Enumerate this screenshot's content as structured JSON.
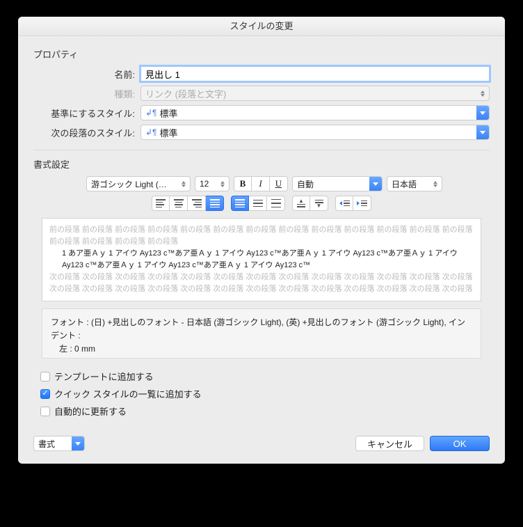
{
  "title": "スタイルの変更",
  "properties": {
    "heading": "プロパティ",
    "name_label": "名前:",
    "name_value": "見出し 1",
    "type_label": "種類:",
    "type_value": "リンク (段落と文字)",
    "base_label": "基準にするスタイル:",
    "base_value": "標準",
    "next_label": "次の段落のスタイル:",
    "next_value": "標準"
  },
  "formatting": {
    "heading": "書式設定",
    "font": "游ゴシック Light (見…",
    "size": "12",
    "bold": "B",
    "italic": "I",
    "underline": "U",
    "color": "自動",
    "language": "日本語"
  },
  "preview": {
    "prev_para": "前の段落 前の段落 前の段落 前の段落 前の段落 前の段落 前の段落 前の段落 前の段落 前の段落 前の段落 前の段落 前の段落 前の段落 前の段落 前の段落 前の段落",
    "sample": "1  あア亜Ａｙ  1  アイウ Ay123 c™あア亜Ａｙ  1  アイウ Ay123 c™あア亜Ａｙ  1  アイウ Ay123 c™あア亜Ａｙ  1  アイウ Ay123 c™あア亜Ａｙ  1  アイウ Ay123 c™あア亜Ａｙ  1  アイウ Ay123 c™",
    "next_para": "次の段落 次の段落 次の段落 次の段落 次の段落 次の段落 次の段落 次の段落 次の段落 次の段落 次の段落 次の段落 次の段落 次の段落 次の段落 次の段落 次の段落 次の段落 次の段落 次の段落 次の段落 次の段落 次の段落 次の段落 次の段落 次の段落"
  },
  "description": {
    "line1": "フォント : (日) +見出しのフォント - 日本語 (游ゴシック Light), (英) +見出しのフォント (游ゴシック Light), インデント :",
    "line2": "　左 :  0 mm"
  },
  "checks": {
    "template": "テンプレートに追加する",
    "quickstyle": "クイック スタイルの一覧に追加する",
    "autoupdate": "自動的に更新する"
  },
  "footer": {
    "format": "書式",
    "cancel": "キャンセル",
    "ok": "OK"
  }
}
